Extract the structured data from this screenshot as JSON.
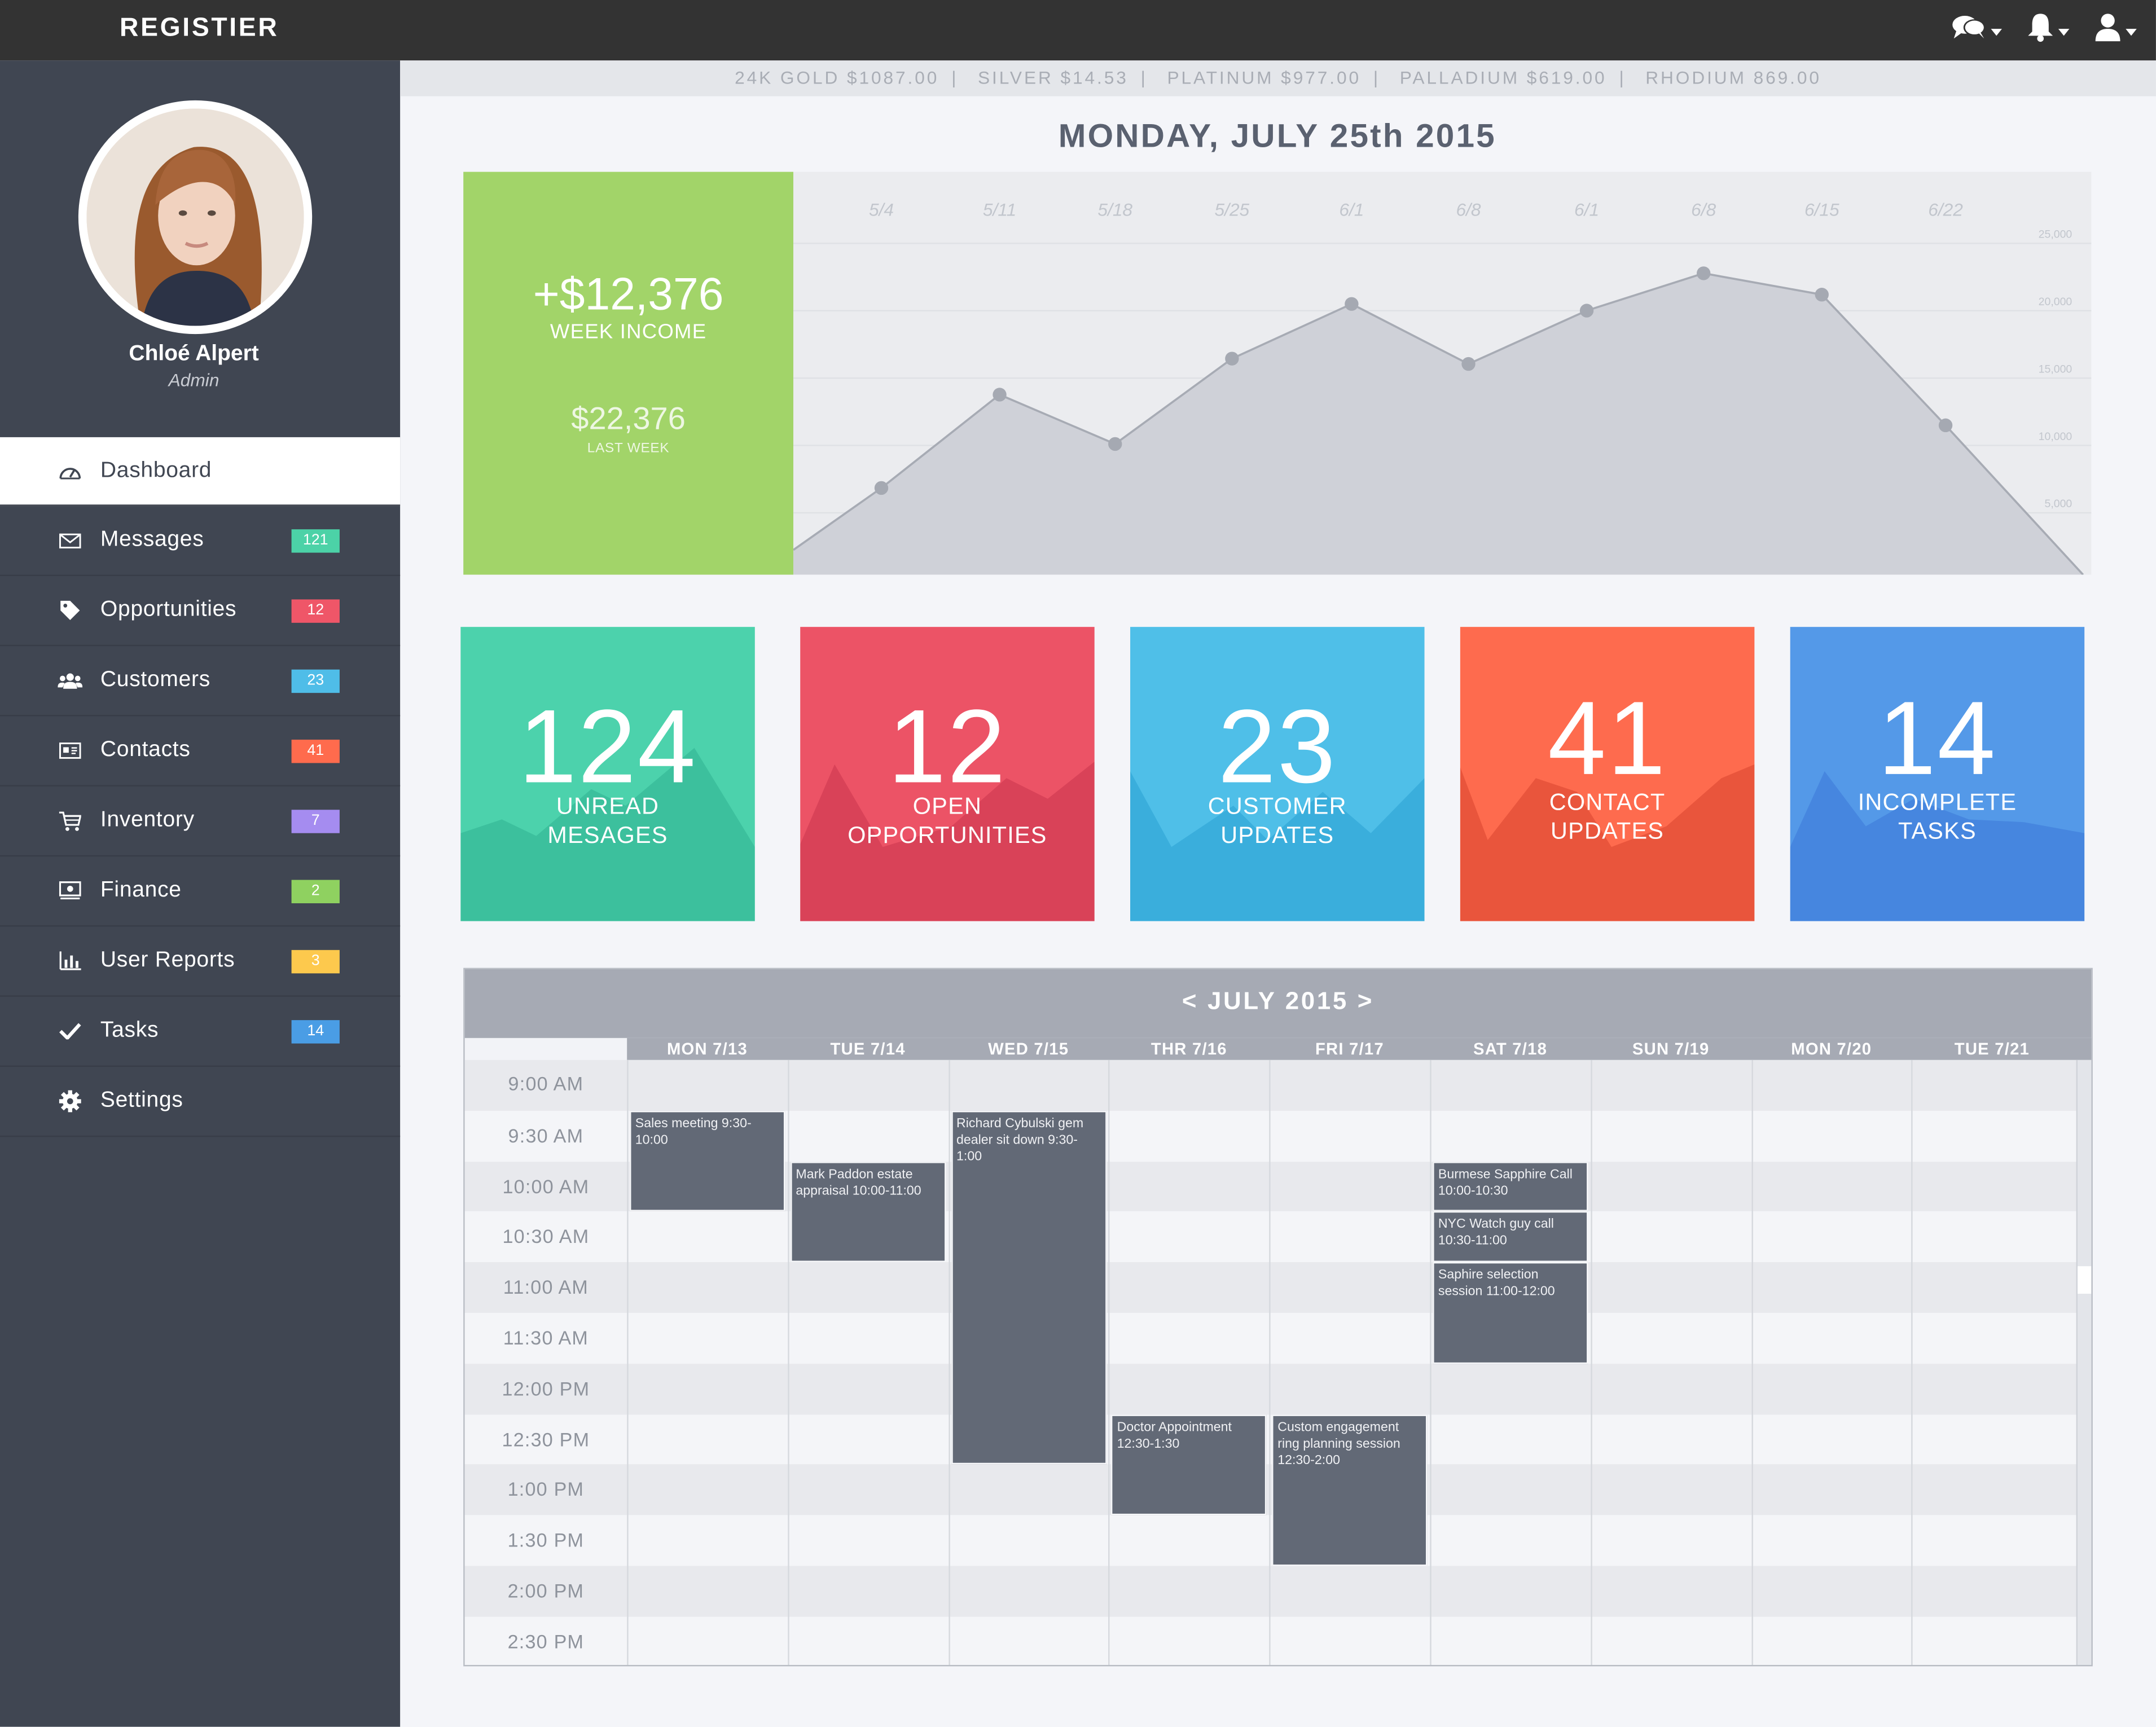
{
  "app": {
    "brand": "REGISTIER"
  },
  "user": {
    "name": "Chloé Alpert",
    "role": "Admin"
  },
  "nav": [
    {
      "label": "Dashboard",
      "icon": "dashboard-icon",
      "active": true
    },
    {
      "label": "Messages",
      "icon": "envelope-icon",
      "badge": "121",
      "badge_color": "#4cd2a7"
    },
    {
      "label": "Opportunities",
      "icon": "tag-icon",
      "badge": "12",
      "badge_color": "#ef5668"
    },
    {
      "label": "Customers",
      "icon": "users-icon",
      "badge": "23",
      "badge_color": "#4fbde8"
    },
    {
      "label": "Contacts",
      "icon": "contact-card-icon",
      "badge": "41",
      "badge_color": "#ff6b4d"
    },
    {
      "label": "Inventory",
      "icon": "cart-icon",
      "badge": "7",
      "badge_color": "#a58cf0"
    },
    {
      "label": "Finance",
      "icon": "money-icon",
      "badge": "2",
      "badge_color": "#8fd160"
    },
    {
      "label": "User Reports",
      "icon": "bar-chart-icon",
      "badge": "3",
      "badge_color": "#fdc94d"
    },
    {
      "label": "Tasks",
      "icon": "check-icon",
      "badge": "14",
      "badge_color": "#4a9de5"
    },
    {
      "label": "Settings",
      "icon": "gear-icon"
    }
  ],
  "ticker": [
    "24K GOLD $1087.00",
    "SILVER $14.53",
    "PLATINUM $977.00",
    "PALLADIUM $619.00",
    "RHODIUM 869.00"
  ],
  "date_title": "MONDAY, JULY 25th 2015",
  "income": {
    "value": "+$12,376",
    "label": "WEEK INCOME",
    "last_value": "$22,376",
    "last_label": "LAST WEEK"
  },
  "chart_data": {
    "type": "area",
    "x": [
      "5/4",
      "5/11",
      "5/18",
      "5/25",
      "6/1",
      "6/8",
      "6/1",
      "6/8",
      "6/15",
      "6/22"
    ],
    "values": [
      6500,
      13500,
      9800,
      16200,
      20300,
      15800,
      19800,
      22600,
      21000,
      11200
    ],
    "y_ticks": [
      "25,000",
      "20,000",
      "15,000",
      "10,000",
      "5,000"
    ],
    "ylim": [
      0,
      25000
    ],
    "grid": true
  },
  "stats": [
    {
      "number": "124",
      "label1": "UNREAD",
      "label2": "MESAGES",
      "color": "#4cd2ac",
      "dark": "#3cc09d"
    },
    {
      "number": "12",
      "label1": "OPEN",
      "label2": "OPPORTUNITIES",
      "color": "#ec5366",
      "dark": "#d94258"
    },
    {
      "number": "23",
      "label1": "CUSTOMER",
      "label2": "UPDATES",
      "color": "#4fbfe8",
      "dark": "#3aaedc"
    },
    {
      "number": "41",
      "label1": "CONTACT",
      "label2": "UPDATES",
      "color": "#fe6b4e",
      "dark": "#e9553c"
    },
    {
      "number": "14",
      "label1": "INCOMPLETE",
      "label2": "TASKS",
      "color": "#5499e8",
      "dark": "#4686df"
    }
  ],
  "calendar": {
    "title": "< JULY 2015 >",
    "days": [
      "MON 7/13",
      "TUE 7/14",
      "WED 7/15",
      "THR 7/16",
      "FRI 7/17",
      "SAT 7/18",
      "SUN 7/19",
      "MON 7/20",
      "TUE 7/21"
    ],
    "times": [
      "9:00 AM",
      "9:30 AM",
      "10:00 AM",
      "10:30 AM",
      "11:00 AM",
      "11:30 AM",
      "12:00 PM",
      "12:30 PM",
      "1:00 PM",
      "1:30 PM",
      "2:00 PM",
      "2:30 PM"
    ],
    "events": [
      {
        "day": 0,
        "start": 1,
        "end": 3,
        "text": "Sales meeting 9:30-10:00"
      },
      {
        "day": 1,
        "start": 2,
        "end": 4,
        "text": "Mark Paddon estate appraisal 10:00-11:00"
      },
      {
        "day": 2,
        "start": 1,
        "end": 8,
        "text": "Richard Cybulski gem dealer sit down 9:30-1:00"
      },
      {
        "day": 3,
        "start": 7,
        "end": 9,
        "text": "Doctor Appointment 12:30-1:30"
      },
      {
        "day": 4,
        "start": 7,
        "end": 10,
        "text": "Custom engagement ring planning session 12:30-2:00"
      },
      {
        "day": 5,
        "start": 2,
        "end": 3,
        "text": "Burmese Sapphire Call 10:00-10:30"
      },
      {
        "day": 5,
        "start": 3,
        "end": 4,
        "text": "NYC Watch guy call 10:30-11:00"
      },
      {
        "day": 5,
        "start": 4,
        "end": 6,
        "text": "Saphire selection session 11:00-12:00"
      }
    ]
  }
}
